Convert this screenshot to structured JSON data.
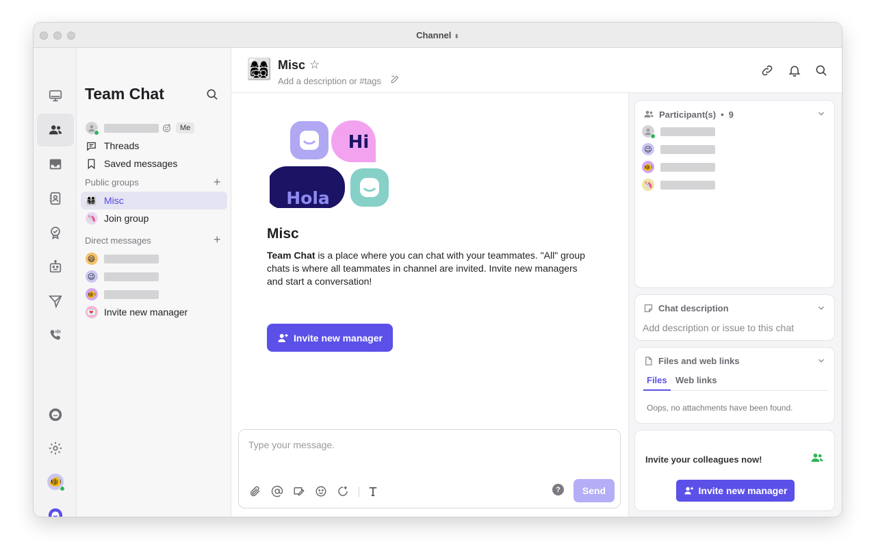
{
  "window": {
    "title": "Channel"
  },
  "rail": {
    "items": [
      "monitor-icon",
      "users-icon",
      "inbox-icon",
      "contacts-icon",
      "badge-icon",
      "bot-icon",
      "send-icon",
      "phone-icon"
    ],
    "bottom": [
      "chat-bubble-icon",
      "gear-icon",
      "user-avatar",
      "brand-icon"
    ]
  },
  "list": {
    "title": "Team Chat",
    "me_badge": "Me",
    "threads": "Threads",
    "saved": "Saved messages",
    "public_groups": "Public groups",
    "groups": [
      {
        "emoji": "👩‍👩‍👧‍👦",
        "label": "Misc"
      },
      {
        "emoji": "🦄",
        "label": "Join group"
      }
    ],
    "direct_messages": "Direct messages",
    "dm_emojis": [
      "😄",
      "😉",
      "🐠"
    ],
    "invite": "Invite new manager",
    "invite_emoji": "💌"
  },
  "header": {
    "emoji": "👩‍👩‍👧‍👦",
    "name": "Misc",
    "description": "Add a description or #tags"
  },
  "hero": {
    "bubble_hi": "Hi",
    "bubble_hola": "Hola",
    "title": "Misc",
    "body_bold": "Team Chat",
    "body_rest": " is a place where you can chat with your teammates. \"All\" group chats is where all teammates in channel are invited. Invite new managers and start a conversation!",
    "button": "Invite new manager"
  },
  "composer": {
    "placeholder": "Type your message.",
    "help": "?",
    "send": "Send"
  },
  "participants": {
    "label": "Participant(s)",
    "count": "9",
    "emojis": [
      "",
      "😉",
      "🐠",
      "🦄"
    ]
  },
  "chat_description": {
    "label": "Chat description",
    "placeholder": "Add description or issue to this chat"
  },
  "files": {
    "label": "Files and web links",
    "tab_files": "Files",
    "tab_links": "Web links",
    "empty": "Oops, no attachments have been found."
  },
  "invite_card": {
    "text": "Invite your colleagues now!",
    "button": "Invite new manager"
  },
  "colors": {
    "accent": "#5b50e8",
    "online": "#2fb45a"
  }
}
